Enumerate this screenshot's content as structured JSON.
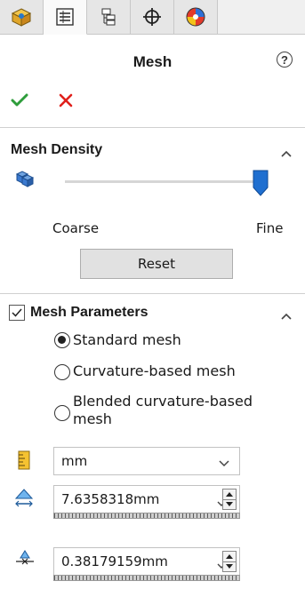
{
  "tabs": [
    {
      "name": "feature-manager",
      "icon": "part-cube-icon",
      "active": false
    },
    {
      "name": "property-manager",
      "icon": "property-list-icon",
      "active": true
    },
    {
      "name": "configuration-manager",
      "icon": "configuration-icon",
      "active": false
    },
    {
      "name": "dimxpert-manager",
      "icon": "crosshair-icon",
      "active": false
    },
    {
      "name": "display-manager",
      "icon": "appearance-sphere-icon",
      "active": false
    }
  ],
  "header": {
    "title": "Mesh",
    "help_glyph": "?"
  },
  "mesh_density": {
    "title": "Mesh Density",
    "slider_level": 1.0,
    "coarse_label": "Coarse",
    "fine_label": "Fine",
    "reset_label": "Reset"
  },
  "mesh_parameters": {
    "title": "Mesh Parameters",
    "checked": true,
    "options": [
      {
        "label": "Standard mesh",
        "selected": true
      },
      {
        "label": "Curvature-based mesh",
        "selected": false
      },
      {
        "label_line1": "Blended curvature-based",
        "label_line2": "mesh",
        "selected": false
      }
    ],
    "unit_value": "mm",
    "global_size": "7.6358318mm",
    "tolerance": "0.38179159mm"
  },
  "colors": {
    "accent": "#1f6fd0",
    "ok": "#2e9d3b",
    "cancel": "#e0201b"
  }
}
